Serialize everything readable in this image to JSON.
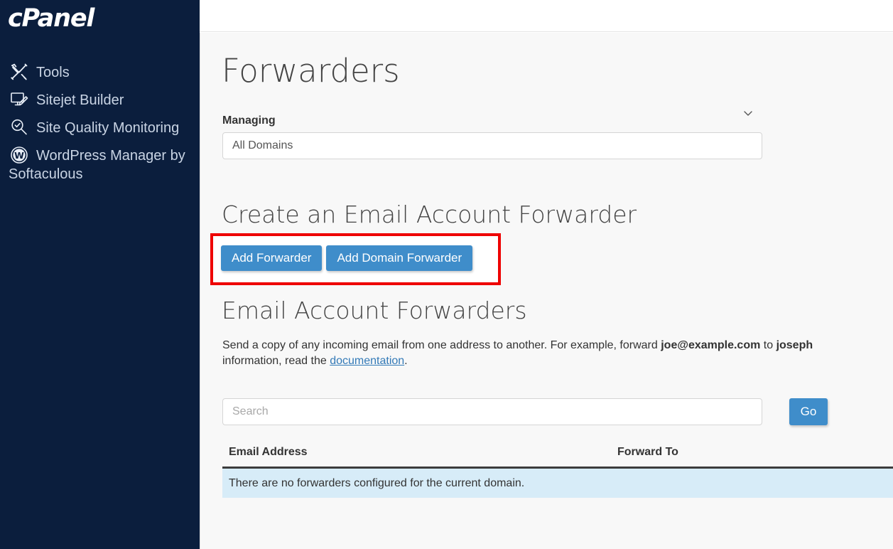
{
  "brand": {
    "logo_text": "cPanel"
  },
  "sidebar": {
    "items": [
      {
        "icon": "tools-icon",
        "label": "Tools"
      },
      {
        "icon": "sitejet-builder-icon",
        "label": "Sitejet Builder"
      },
      {
        "icon": "site-quality-monitoring-icon",
        "label": "Site Quality Monitoring"
      },
      {
        "icon": "wordpress-icon",
        "label": "WordPress Manager by Softaculous"
      }
    ]
  },
  "main": {
    "page_title": "Forwarders",
    "managing": {
      "label": "Managing",
      "selected": "All Domains",
      "options": [
        "All Domains"
      ]
    },
    "create_section": {
      "heading": "Create an Email Account Forwarder",
      "add_forwarder_label": "Add Forwarder",
      "add_domain_forwarder_label": "Add Domain Forwarder"
    },
    "list_section": {
      "heading": "Email Account Forwarders",
      "description_part1": "Send a copy of any incoming email from one address to another. For example, forward ",
      "description_email_from": "joe@example.com",
      "description_part2": " to ",
      "description_email_to": "joseph",
      "description_line2_prefix": "information, read the ",
      "description_link": "documentation",
      "description_line2_suffix": "."
    },
    "search": {
      "placeholder": "Search",
      "value": "",
      "go_label": "Go"
    },
    "table": {
      "columns": [
        "Email Address",
        "Forward To"
      ],
      "empty_message": "There are no forwarders configured for the current domain.",
      "rows": []
    }
  },
  "colors": {
    "sidebar_bg": "#0b1e3d",
    "button_blue": "#3f8dca",
    "highlight_red": "#ee0000",
    "info_row_bg": "#d7ecf8",
    "link_blue": "#337ab7",
    "content_bg": "#f8f8f8"
  }
}
